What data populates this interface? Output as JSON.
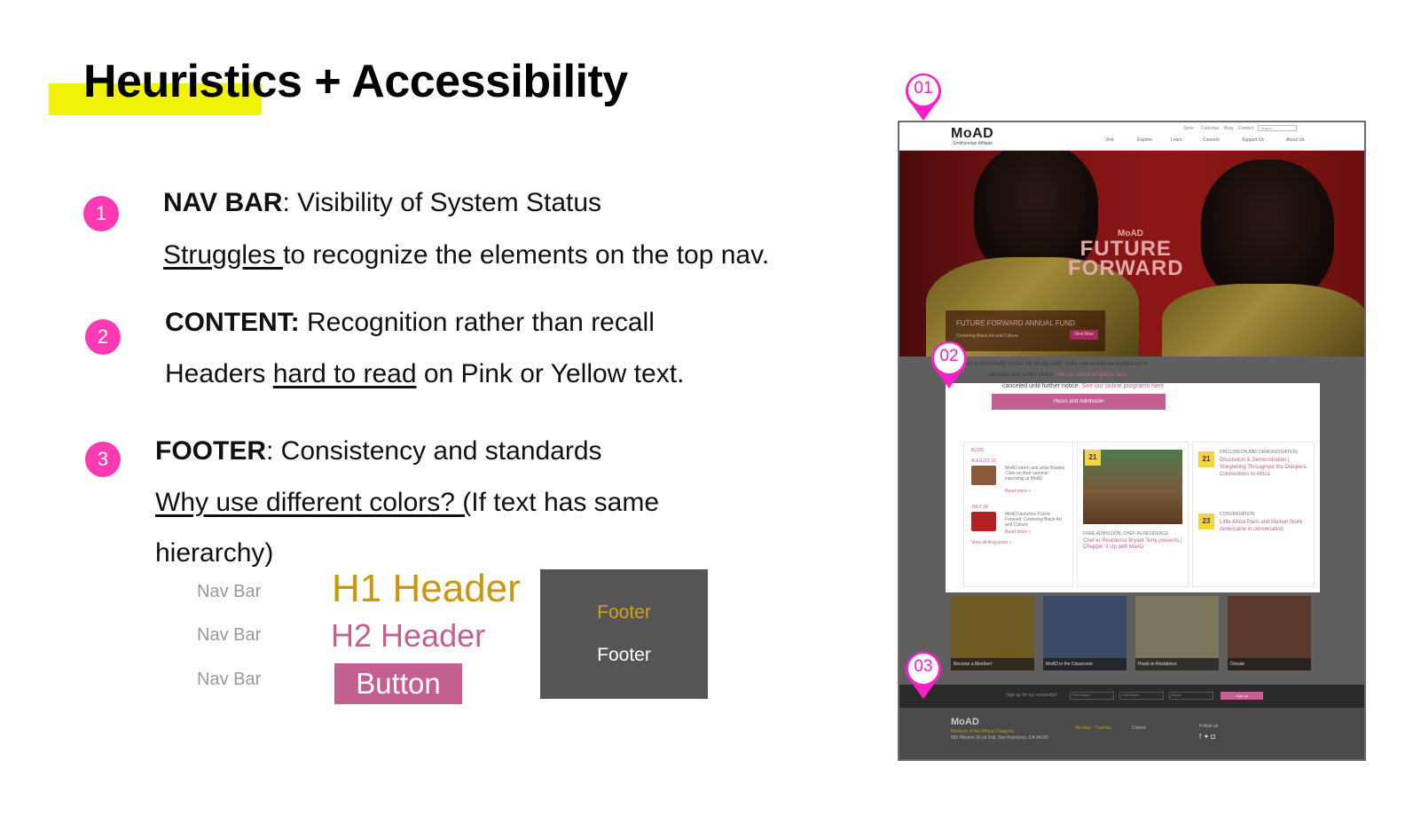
{
  "slide": {
    "title": "Heuristics + Accessibility"
  },
  "points": [
    {
      "number": "1",
      "heading": "NAV BAR",
      "heading_rest": ": Visibility of System Status",
      "detail_underlined": "Struggles ",
      "detail_rest": "to recognize the elements on the top nav."
    },
    {
      "number": "2",
      "heading": "CONTENT:",
      "heading_rest": " Recognition rather than recall",
      "detail_prefix": "Headers ",
      "detail_underlined": "hard to read",
      "detail_rest": " on Pink or Yellow  text."
    },
    {
      "number": "3",
      "heading": "FOOTER",
      "heading_rest": ": Consistency and standards",
      "detail_underlined": "Why use different colors? (",
      "detail_rest": "If text has same",
      "detail_line2": "hierarchy)"
    }
  ],
  "legend": {
    "nav_samples": [
      "Nav Bar",
      "Nav Bar",
      "Nav Bar"
    ],
    "h1": "H1 Header",
    "h2": "H2 Header",
    "button": "Button",
    "footer_gold": "Footer",
    "footer_white": "Footer"
  },
  "colors": {
    "highlight": "#f2f20a",
    "number_badge": "#ff3bb3",
    "pin": "#ff1ec8",
    "h1_gold": "#c8980c",
    "h2_pink": "#c3608f",
    "footer_bg": "#555555"
  },
  "pins": [
    "01",
    "02",
    "03"
  ],
  "mockup": {
    "logo": "MoAD",
    "logo_sub": "Smithsonian Affiliate",
    "top_links": [
      "Store",
      "Calendar",
      "Blog",
      "Contact"
    ],
    "search_placeholder": "Search",
    "main_links": [
      "Visit",
      "Explore",
      "Learn",
      "Connect",
      "Support Us",
      "About Us"
    ],
    "hero_logo": "MoAD",
    "hero_title_1": "FUTURE",
    "hero_title_2": "FORWARD",
    "hero_caption": "FUTURE FORWARD ANNUAL FUND",
    "hero_sub": "Centering Black Art and Culture",
    "hero_button": "Give Now",
    "notice_1": "MoAD is temporarily closed. All on-site visits, tours, and events are postponed or",
    "notice_2": "canceled until further notice.",
    "notice_link": "See our online programs here.",
    "hours_button": "Hours and Admission",
    "blog_label": "BLOG",
    "blog_date_1": "AUGUST 19",
    "blog_item_1": "MoAD intern and artist Rawley Clark on their summer internship at MoAD",
    "blog_date_2": "JULY 28",
    "blog_item_2": "MoAD launches Future Forward: Centering Black Art and Culture",
    "read_more": "Read more »",
    "view_all": "View all blog posts »",
    "event_date_1": "21",
    "event_tag": "FREE ADMISSION, CHEF-IN-RESIDENCE",
    "event_title": "Chef-in-Residence Bryant Terry presents | Choppin' It Up with MoAD",
    "side_date_1": "21",
    "side_tag_1": "DISCUSSION AND DEMONSTRATION",
    "side_title_1": "Discussion & Demonstration | Storytelling Throughout the Diaspora: Connections to Africa",
    "side_date_2": "23",
    "side_tag_2": "CONVERSATION",
    "side_title_2": "Little Africa Paris and Maison Noire Américaine in conversation",
    "tiles": [
      "Become a Member!",
      "MoAD in the Classroom",
      "Poets-in-Residence",
      "Donate"
    ],
    "newsletter_label": "Sign up for our newsletter!",
    "newsletter_fields": [
      "First Name",
      "Last Name",
      "Email"
    ],
    "newsletter_button": "Sign up",
    "footer_logo": "MoAD",
    "footer_name": "Museum of the African Diaspora",
    "footer_address": "685 Mission St (at 3rd), San Francisco, CA 94105",
    "footer_days": "Monday - Tuesday",
    "footer_status": "Closed",
    "footer_follow": "Follow us:"
  }
}
